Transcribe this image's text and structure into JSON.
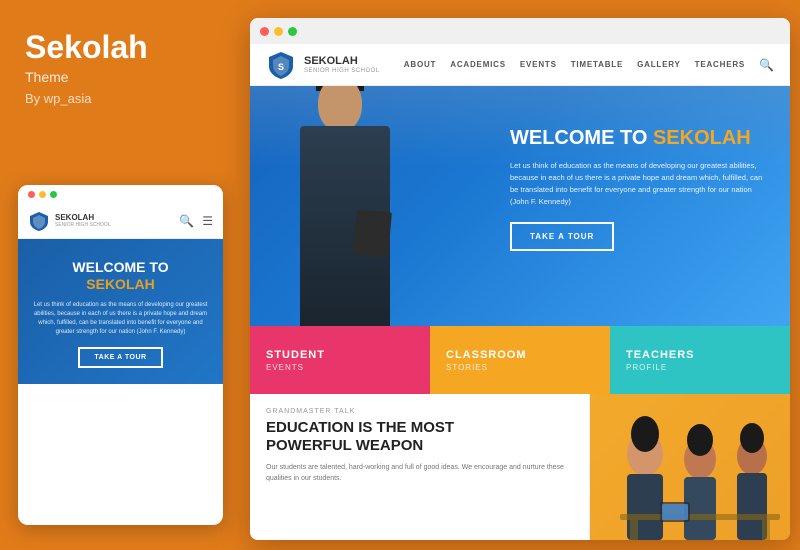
{
  "left": {
    "title": "Sekolah",
    "subtitle": "Theme",
    "author": "By wp_asia"
  },
  "mobile": {
    "logo_name": "SEKOLAH",
    "logo_sub": "SENIOR HIGH SCHOOL",
    "hero_line1": "WELCOME TO",
    "hero_brand": "SEKOLAH",
    "hero_text": "Let us think of education as the means of developing our greatest abilities, because in each of us there is a private hope and dream which, fulfilled, can be translated into benefit for everyone and greater strength for our nation (John F. Kennedy)",
    "cta_button": "TAKE A TOUR"
  },
  "desktop": {
    "nav_links": [
      "ABOUT",
      "ACADEMICS",
      "EVENTS",
      "TIMETABLE",
      "GALLERY",
      "TEACHERS"
    ],
    "logo_name": "SEKOLAH",
    "logo_sub": "SENIOR HIGH SCHOOL",
    "hero_welcome": "WELCOME TO",
    "hero_brand": "SEKOLAH",
    "hero_text": "Let us think of education as the means of developing our greatest abilities, because in each of us there is a private hope and dream which, fulfilled, can be translated into benefit for everyone and greater strength for our nation (John F. Kennedy)",
    "hero_cta": "TAKE A TOUR",
    "feature_boxes": [
      {
        "title": "STUDENT",
        "sub": "EVENTS"
      },
      {
        "title": "CLASSROOM",
        "sub": "STORIES"
      },
      {
        "title": "TEACHERS",
        "sub": "PROFILE"
      }
    ],
    "bottom_tag": "Grandmaster Talk",
    "bottom_heading_line1": "EDUCATION IS THE MOST",
    "bottom_heading_line2": "POWERFUL WEAPON",
    "bottom_body": "Our students are talented, hard-working and full of good ideas. We encourage and nurture these qualities in our students."
  },
  "colors": {
    "orange": "#e07b1a",
    "blue": "#1a5fa8",
    "pink": "#e8366a",
    "amber": "#f5a623",
    "teal": "#2ec4c4"
  }
}
